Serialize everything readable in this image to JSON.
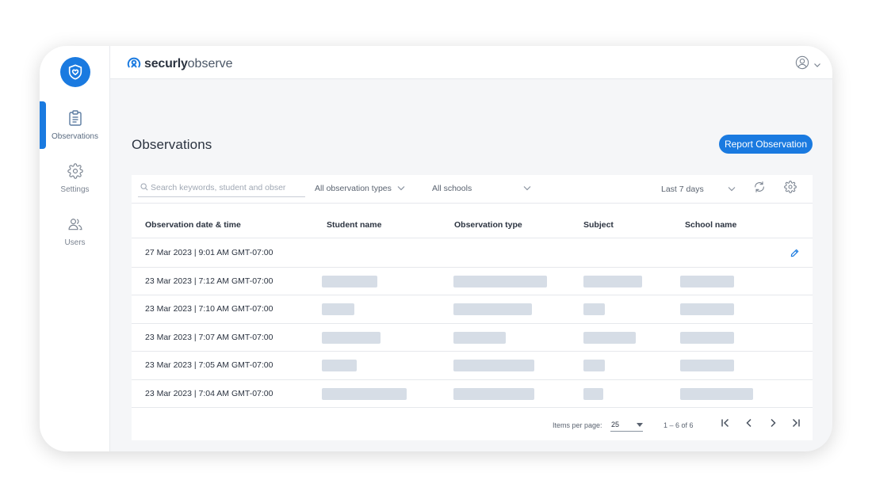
{
  "brand": {
    "part1": "securly",
    "part2": "observe"
  },
  "sidebar": {
    "items": [
      {
        "label": "Observations",
        "icon": "clipboard-icon",
        "active": true
      },
      {
        "label": "Settings",
        "icon": "gear-icon",
        "active": false
      },
      {
        "label": "Users",
        "icon": "users-icon",
        "active": false
      }
    ]
  },
  "main": {
    "title": "Observations",
    "report_button": "Report Observation"
  },
  "filters": {
    "search_placeholder": "Search keywords, student and obser",
    "observation_types": "All observation types",
    "schools": "All schools",
    "date_range": "Last 7 days"
  },
  "table": {
    "columns": [
      "Observation date & time",
      "Student name",
      "Observation type",
      "Subject",
      "School name"
    ],
    "rows": [
      {
        "date": "27 Mar 2023 | 9:01 AM GMT-07:00"
      },
      {
        "date": "23 Mar 2023 | 7:12 AM GMT-07:00"
      },
      {
        "date": "23 Mar 2023 | 7:10 AM GMT-07:00"
      },
      {
        "date": "23 Mar 2023 | 7:07 AM GMT-07:00"
      },
      {
        "date": "23 Mar 2023 | 7:05 AM GMT-07:00"
      },
      {
        "date": "23 Mar 2023 | 7:04 AM GMT-07:00"
      }
    ]
  },
  "pagination": {
    "items_per_page_label": "Items per page:",
    "items_per_page": "25",
    "range": "1 – 6 of 6"
  },
  "colors": {
    "accent": "#1a7ae0",
    "redacted": "#d6dde6"
  }
}
